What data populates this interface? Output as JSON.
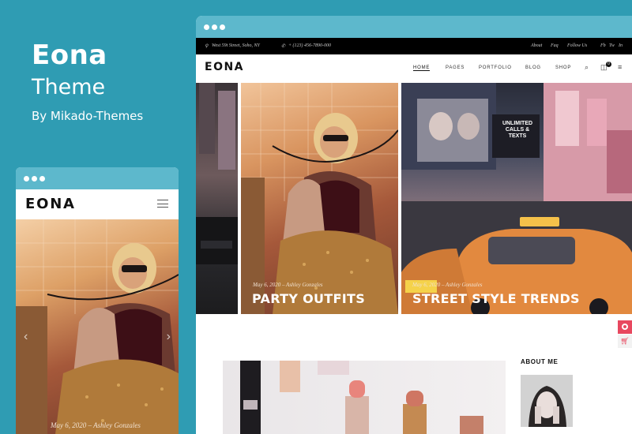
{
  "promo": {
    "title": "Eona",
    "subtitle": "Theme",
    "by": "By Mikado-Themes"
  },
  "desktop": {
    "topbar": {
      "address": "West 59t Street, Soho, NY",
      "phone": "+ (123) 456-7890-000",
      "links": [
        "About",
        "Faq",
        "Follow Us"
      ],
      "social": [
        "Fb",
        "Tw",
        "In"
      ]
    },
    "logo": "EONA",
    "nav": [
      "HOME",
      "PAGES",
      "PORTFOLIO",
      "BLOG",
      "SHOP"
    ],
    "cart_count": "0",
    "hero": [
      {
        "meta": "May 6, 2020 – Ashley Gonzales",
        "caption": "PARTY OUTFITS"
      },
      {
        "meta": "May 6, 2020 – Ashley Gonzales",
        "caption": "STREET STYLE TRENDS"
      }
    ],
    "billboard_text": "UNLIMITED CALLS & TEXTS",
    "sidebar": {
      "about_title": "ABOUT ME"
    },
    "colors": {
      "widget_pink": "#e8485f",
      "widget_bg": "#f2f2f2"
    }
  },
  "mobile": {
    "logo": "EONA",
    "hero_meta": "May 6, 2020 – Ashley Gonzales"
  },
  "icons": [
    "search-icon",
    "cart-icon",
    "menu-icon",
    "hamburger-menu-icon",
    "chevron-left-icon",
    "chevron-right-icon",
    "cart-widget-icon",
    "ring-widget-icon"
  ]
}
